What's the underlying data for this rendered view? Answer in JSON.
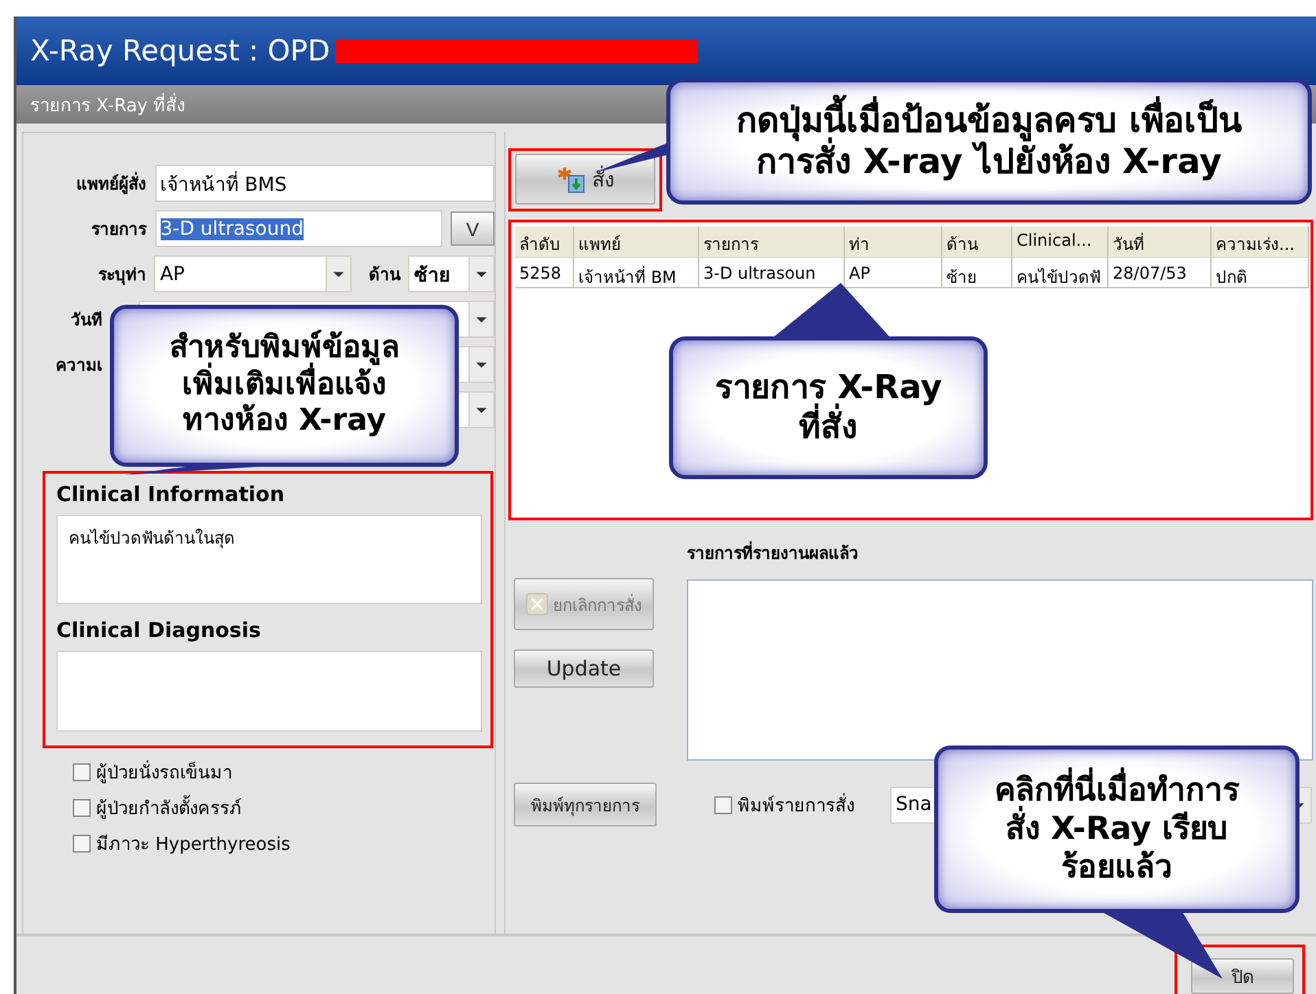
{
  "window": {
    "title": "X-Ray Request : OPD"
  },
  "subtitle": "รายการ X-Ray ที่สั่ง",
  "form": {
    "doctor": {
      "label": "แพทย์ผู้สั่ง",
      "value": "เจ้าหน้าที่ BMS"
    },
    "item": {
      "label": "รายการ",
      "value": "3-D ultrasound",
      "highlighted": true,
      "button": "V"
    },
    "position": {
      "label": "ระบุท่า",
      "value": "AP"
    },
    "side": {
      "label": "ด้าน",
      "value": "ซ้าย"
    },
    "date": {
      "label": "วันที"
    },
    "urgency": {
      "label": "ความเ"
    }
  },
  "clinical": {
    "info_label": "Clinical Information",
    "info_value": "คนไข้ปวดฟันด้านในสุด",
    "diagnosis_label": "Clinical Diagnosis"
  },
  "checkboxes": [
    {
      "label": "ผู้ป่วยนั่งรถเข็นมา",
      "checked": false
    },
    {
      "label": "ผู้ป่วยกำลังตั้งครรภ์",
      "checked": false
    },
    {
      "label": "มีภาวะ Hyperthyreosis",
      "checked": false
    }
  ],
  "order_button": "สั่ง",
  "table": {
    "columns": [
      "ลำดับ",
      "แพทย์",
      "รายการ",
      "ท่า",
      "ด้าน",
      "Clinical...",
      "วันที่",
      "ความเร่ง..."
    ],
    "rows": [
      [
        "5258",
        "เจ้าหน้าที่ BM",
        "3-D ultrasoun",
        "AP",
        "ซ้าย",
        "คนไข้ปวดฟั",
        "28/07/53",
        "ปกติ"
      ]
    ]
  },
  "cancel_button": {
    "label": "ยกเลิกการสั่ง",
    "disabled": true
  },
  "update_button": {
    "label": "Update",
    "disabled": false
  },
  "reported_label": "รายการที่รายงานผลแล้ว",
  "print_all_button": "พิมพ์ทุกรายการ",
  "print_order": {
    "label": "พิมพ์รายการสั่ง",
    "checked": false
  },
  "printer_combo": "Sna",
  "close_button": "ปิด",
  "callouts": [
    {
      "text": "กดปุ่มนี้เมื่อป้อนข้อมูลครบ เพื่อเป็น\nการสั่ง X-ray ไปยังห้อง X-ray"
    },
    {
      "text": "สำหรับพิมพ์ข้อมูล\nเพิ่มเติมเพื่อแจ้ง\nทางห้อง X-ray"
    },
    {
      "text": "รายการ X-Ray\nที่สั่ง"
    },
    {
      "text": "คลิกที่นี่เมื่อทำการ\nสั่ง X-Ray เรียบ\nร้อยแล้ว"
    }
  ]
}
